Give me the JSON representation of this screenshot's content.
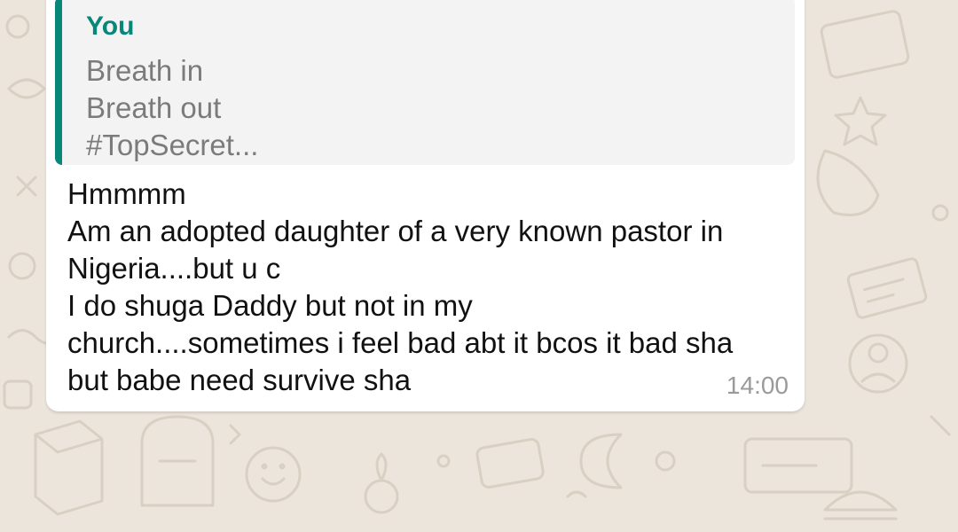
{
  "chat": {
    "background_color": "#ece5dc",
    "bubble_color": "#ffffff",
    "accent_color": "#07877a"
  },
  "message": {
    "quoted": {
      "author": "You",
      "lines": [
        "Breath in",
        "Breath out",
        "#TopSecret..."
      ]
    },
    "lines": [
      "Hmmmm",
      "Am an adopted daughter of a very known pastor in",
      "Nigeria....but u c",
      "I do shuga Daddy but not in my",
      "church....sometimes i feel bad abt it bcos it bad sha",
      "but babe need survive sha"
    ],
    "time": "14:00"
  }
}
